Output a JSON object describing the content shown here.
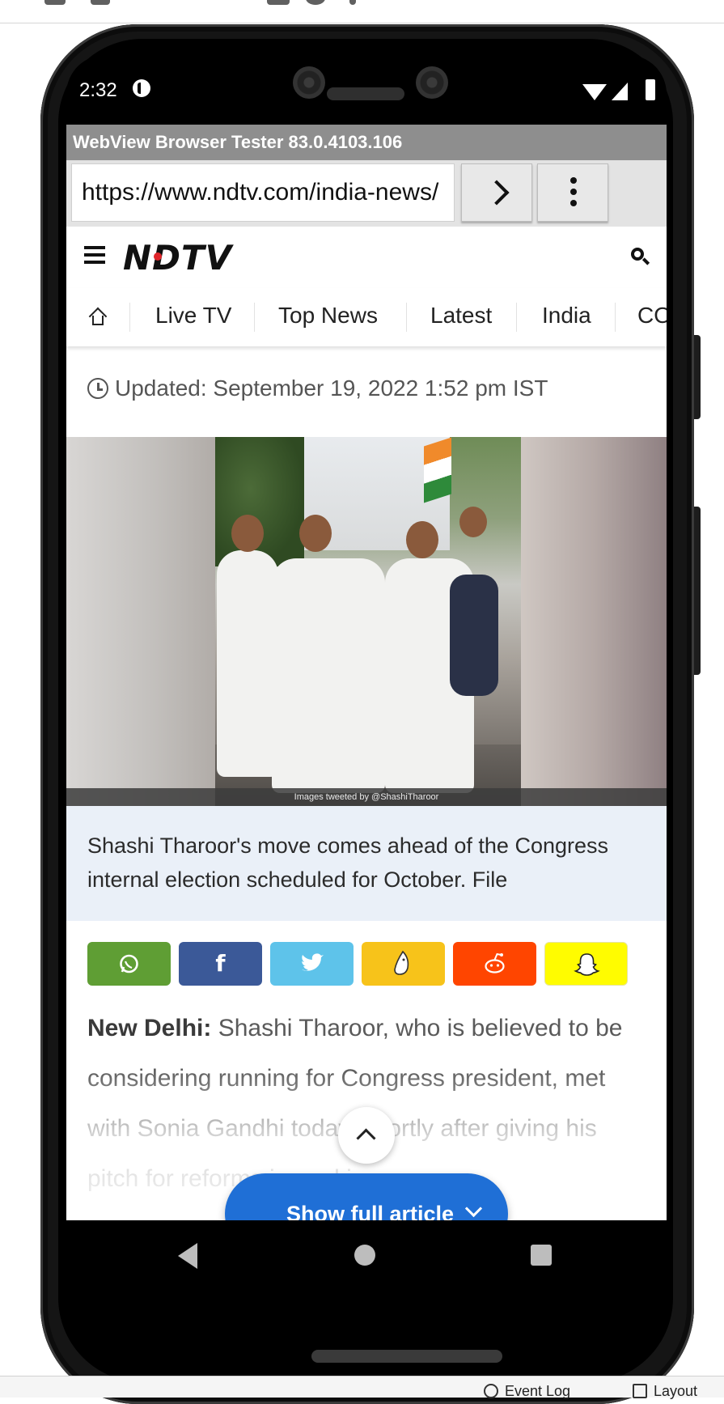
{
  "host": {
    "bottom_tools": [
      "Event Log",
      "Layout"
    ]
  },
  "status_bar": {
    "time": "2:32"
  },
  "tester": {
    "title": "WebView Browser Tester 83.0.4103.106",
    "url": "https://www.ndtv.com/india-news/"
  },
  "site": {
    "logo": "NDTV",
    "nav": [
      "Live TV",
      "Top News",
      "Latest",
      "India",
      "CO"
    ],
    "updated": "Updated: September 19, 2022 1:52 pm IST",
    "image_credit": "Images tweeted by @ShashiTharoor",
    "image_caption": "Shashi Tharoor's move comes ahead of the Congress internal election scheduled for October. File",
    "share": [
      {
        "icon": "whatsapp-icon",
        "color": "#5f9e34"
      },
      {
        "icon": "facebook-icon",
        "glyph": "f",
        "color": "#3b5998"
      },
      {
        "icon": "twitter-icon",
        "color": "#5ec3ea"
      },
      {
        "icon": "koo-icon",
        "color": "#f7c31a"
      },
      {
        "icon": "reddit-icon",
        "color": "#ff4500"
      },
      {
        "icon": "snapchat-icon",
        "color": "#fffc00"
      }
    ],
    "article": {
      "dateline": "New Delhi:",
      "text": " Shashi Tharoor, who is believed to be considering running for Congress president, met with Sonia Gandhi today, shortly after giving his pitch for reforms in seeking"
    },
    "show_full_article": "Show full article"
  }
}
